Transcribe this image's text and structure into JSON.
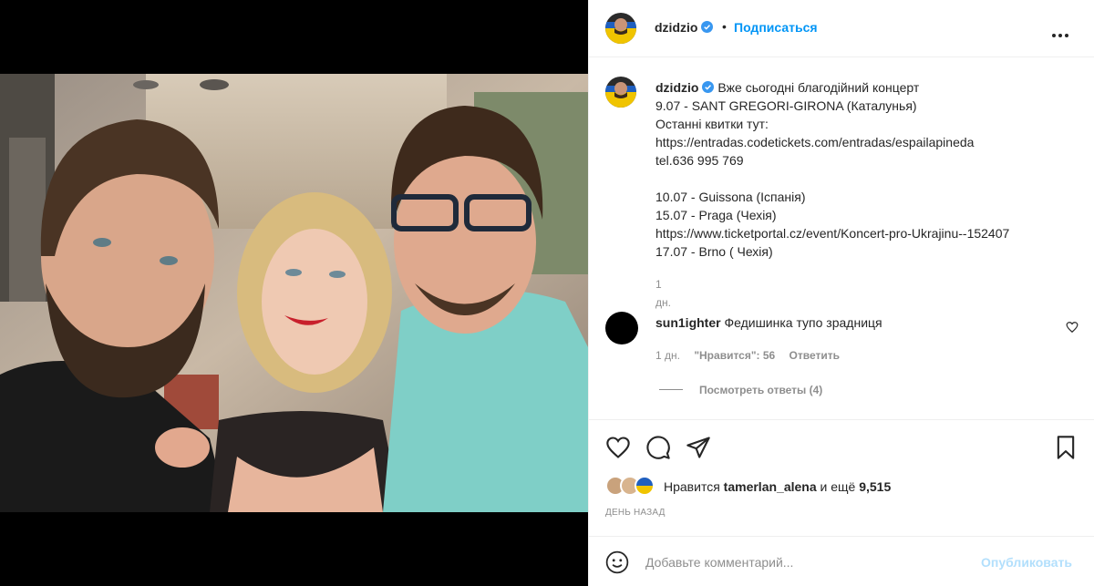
{
  "post": {
    "username": "dzidzio",
    "follow_label": "Подписаться",
    "separator": "•",
    "more_icon": "more-horizontal-icon",
    "verified_icon": "verified-badge-icon",
    "photo_alt": "photo",
    "colors": {
      "link": "#0095f6",
      "link_disabled": "#b2dffc",
      "muted": "#8e8e8e",
      "text": "#262626"
    }
  },
  "caption": {
    "username": "dzidzio",
    "lines": [
      "Вже сьогодні благодійний концерт",
      "9.07 - SANT GREGORI-GIRONA (Каталунья)",
      "Останні квитки тут:",
      "https://entradas.codetickets.com/entradas/espailapineda",
      "tel.636 995 769",
      "",
      "10.07 - Guissona (Іспанія)",
      "15.07 - Praga (Чехія)",
      "https://www.ticketportal.cz/event/Koncert-pro-Ukrajinu--152407",
      "17.07 - Brno ( Чехія)"
    ],
    "time": "1 дн."
  },
  "comment": {
    "username": "sun1ighter",
    "text": "Федишинка тупо зрадниця",
    "time": "1 дн.",
    "likes": "\"Нравится\": 56",
    "reply_label": "Ответить",
    "view_replies": "Посмотреть ответы (4)"
  },
  "actions": {
    "like_icon": "heart-icon",
    "comment_icon": "comment-icon",
    "share_icon": "paper-plane-icon",
    "save_icon": "bookmark-icon"
  },
  "likes": {
    "prefix": "Нравится",
    "user": "tamerlan_alena",
    "conjunction": "и ещё",
    "count": "9,515"
  },
  "post_time": "День назад",
  "add_comment": {
    "placeholder": "Добавьте комментарий...",
    "publish_label": "Опубликовать",
    "emoji_icon": "emoji-smile-icon"
  }
}
